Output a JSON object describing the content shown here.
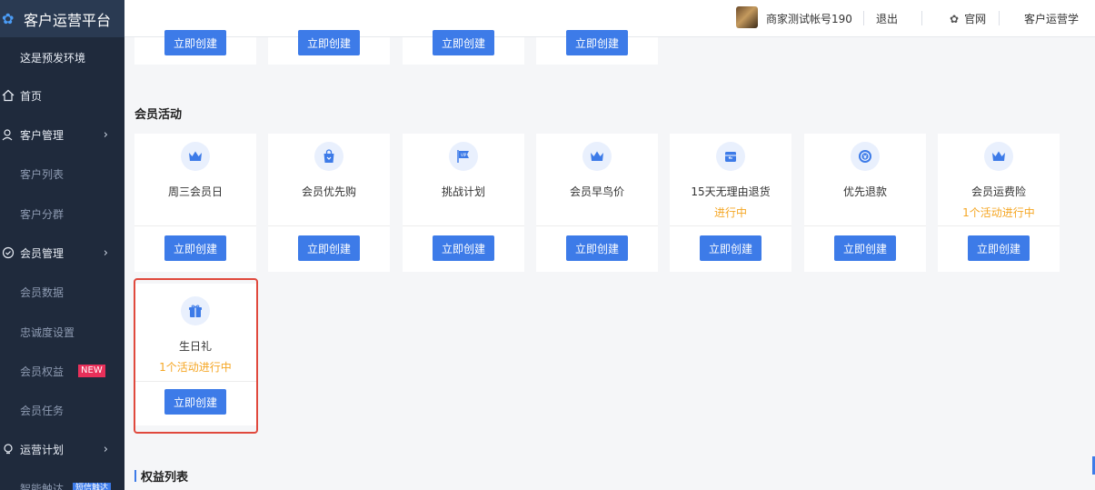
{
  "app": {
    "title": "客户运营平台"
  },
  "sidebar": {
    "env": "这是预发环境",
    "home": "首页",
    "customer_mgmt": "客户管理",
    "customer_list": "客户列表",
    "customer_segment": "客户分群",
    "member_mgmt": "会员管理",
    "member_data": "会员数据",
    "loyalty": "忠诚度设置",
    "member_rights": "会员权益",
    "new_badge": "NEW",
    "member_tasks": "会员任务",
    "ops_plan": "运营计划",
    "smart_reach": "智能触达",
    "sms_badge": "短信触达"
  },
  "header": {
    "account": "商家测试帐号190",
    "logout": "退出",
    "website": "官网",
    "academy": "客户运营学"
  },
  "top_row": {
    "button_label": "立即创建"
  },
  "member_activity": {
    "title": "会员活动",
    "cards": [
      {
        "name": "周三会员日",
        "status": "",
        "icon": "crown-icon",
        "button": "立即创建"
      },
      {
        "name": "会员优先购",
        "status": "",
        "icon": "shopping-bag-icon",
        "button": "立即创建"
      },
      {
        "name": "挑战计划",
        "status": "",
        "icon": "vip-flag-icon",
        "button": "立即创建"
      },
      {
        "name": "会员早鸟价",
        "status": "",
        "icon": "crown-icon",
        "button": "立即创建"
      },
      {
        "name": "15天无理由退货",
        "status": "进行中",
        "icon": "return-box-icon",
        "button": "立即创建"
      },
      {
        "name": "优先退款",
        "status": "",
        "icon": "refund-icon",
        "button": "立即创建"
      },
      {
        "name": "会员运费险",
        "status": "1个活动进行中",
        "icon": "crown-icon",
        "button": "立即创建"
      }
    ],
    "birthday": {
      "name": "生日礼",
      "status": "1个活动进行中",
      "icon": "gift-icon",
      "button": "立即创建"
    }
  },
  "rights_list": {
    "title": "权益列表"
  },
  "colors": {
    "primary": "#3d7be8",
    "sidebar": "#1f2a3c",
    "status": "#f5a623",
    "highlight": "#e0493d"
  }
}
